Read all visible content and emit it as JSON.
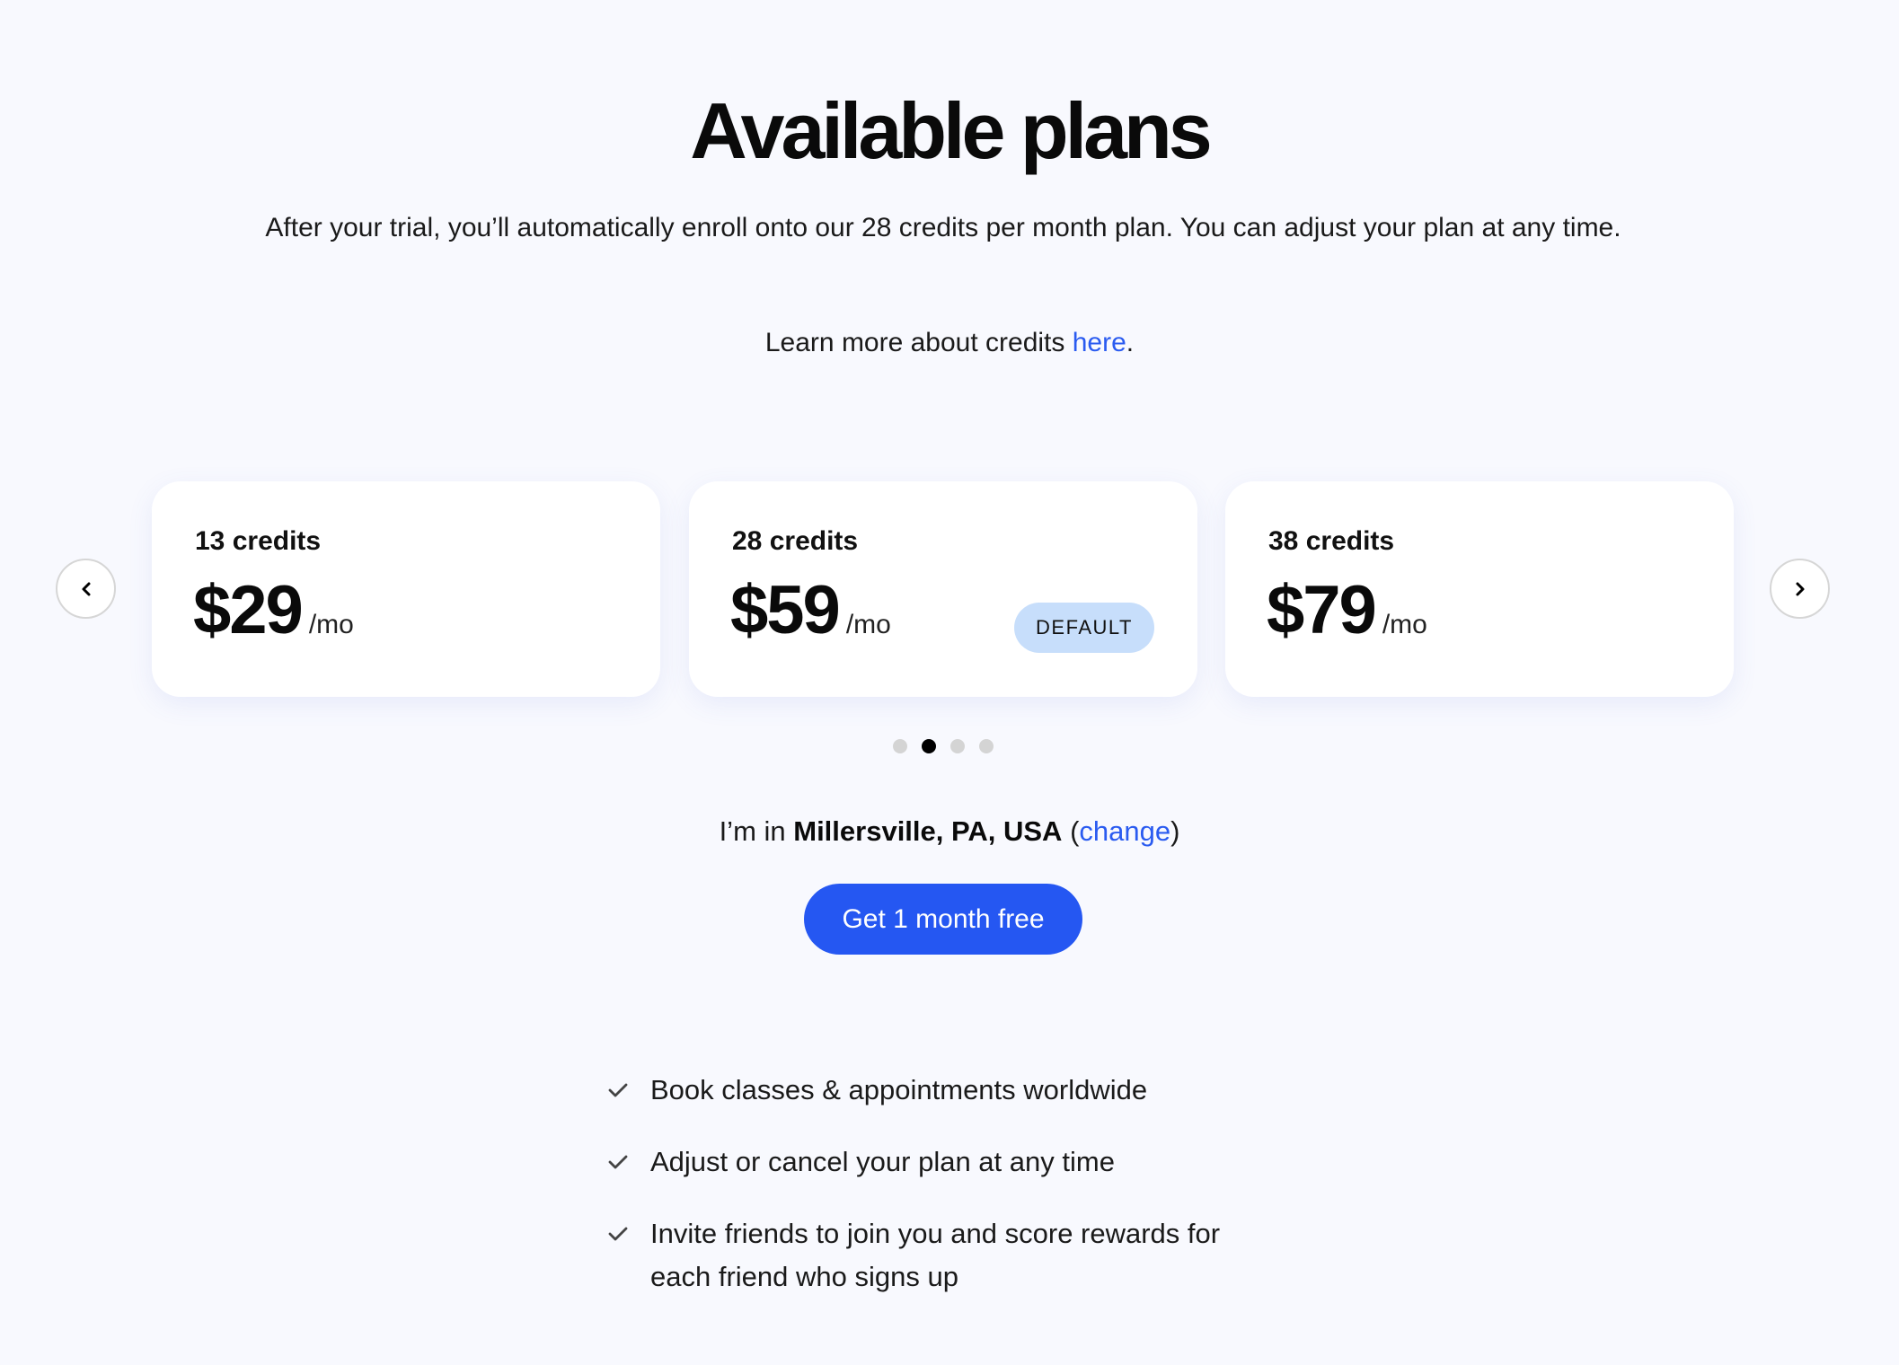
{
  "header": {
    "title": "Available plans",
    "intro": "After your trial, you’ll automatically enroll onto our 28 credits per month plan. You can adjust your plan at any time.",
    "learn_more_prefix": "Learn more about credits ",
    "learn_more_link": "here",
    "learn_more_suffix": "."
  },
  "carousel": {
    "prev_icon": "chevron-left-icon",
    "next_icon": "chevron-right-icon",
    "plans": [
      {
        "credits": "13 credits",
        "price": "$29",
        "period": "/mo",
        "badge": null
      },
      {
        "credits": "28 credits",
        "price": "$59",
        "period": "/mo",
        "badge": "DEFAULT"
      },
      {
        "credits": "38 credits",
        "price": "$79",
        "period": "/mo",
        "badge": null
      }
    ],
    "page_count": 4,
    "active_page": 2
  },
  "location": {
    "prefix": "I’m in ",
    "place": "Millersville, PA, USA",
    "open_paren": " (",
    "change_link": "change",
    "close_paren": ")"
  },
  "cta": {
    "label": "Get 1 month free"
  },
  "features": [
    {
      "icon": "check-icon",
      "text": "Book classes & appointments worldwide"
    },
    {
      "icon": "check-icon",
      "text": "Adjust or cancel your plan at any time"
    },
    {
      "icon": "check-icon",
      "text": "Invite friends to join you and score rewards for each friend who signs up"
    }
  ],
  "colors": {
    "background": "#f8f9fe",
    "link": "#2a5bf0",
    "cta": "#2557f2",
    "badge": "#c7defb",
    "dot_active": "#000000",
    "dot_inactive": "#d4d4d4"
  }
}
